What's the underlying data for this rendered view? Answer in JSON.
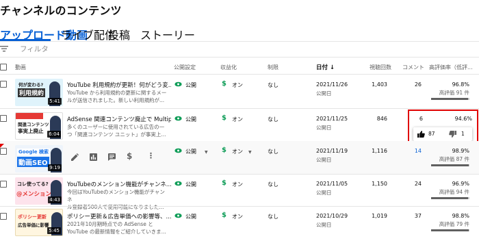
{
  "page": {
    "title": "チャンネルのコンテンツ"
  },
  "tabs": [
    {
      "label": "アップロード動画",
      "active": true
    },
    {
      "label": "ライブ配信",
      "active": false
    },
    {
      "label": "投稿",
      "active": false
    },
    {
      "label": "ストーリー",
      "active": false
    }
  ],
  "filter": {
    "placeholder": "フィルタ",
    "icon": "filter-icon"
  },
  "columns": {
    "video": "動画",
    "visibility": "公開設定",
    "monetization": "収益化",
    "restrictions": "制限",
    "date": "日付",
    "views": "視聴回数",
    "comments": "コメント",
    "likes": "高評価率（低評..."
  },
  "rows": [
    {
      "duration": "5:41",
      "thumb_top": "何が変わる?",
      "thumb_bottom": "利用規約",
      "title": "YouTube 利用規約が更新！何がどう変...",
      "desc1": "YouTube から利用規約の更新に関するメー",
      "desc2": "ルが送信されました。新しい利用規約が...",
      "visibility": "公開",
      "monetization": "オン",
      "restrictions": "なし",
      "date": "2021/11/26",
      "date_status": "公開日",
      "views": "1,403",
      "comments": "26",
      "like_rate": "96.8%",
      "like_count": "高評価 91 件",
      "like_fraction": 0.968
    },
    {
      "duration": "6:04",
      "thumb_top": "関連コンテンツ",
      "thumb_bottom": "事実上廃止",
      "title": "AdSense 関連コンテンツ廃止で Multip...",
      "desc1": "多くのユーザーに使用されている広告の一",
      "desc2": "つ「関連コンテンツ ユニット」が事実上...",
      "visibility": "公開",
      "monetization": "オン",
      "restrictions": "なし",
      "date": "2021/11/25",
      "date_status": "公開日",
      "views": "846",
      "comments": "6",
      "like_rate": "94.6%",
      "likes": "87",
      "dislikes": "1",
      "like_fraction": 0.946
    },
    {
      "duration": "9:19",
      "thumb_top": "Google 検索",
      "thumb_bottom": "動画SEO",
      "visibility": "公開",
      "monetization": "オン",
      "restrictions": "なし",
      "date": "2021/11/19",
      "date_status": "公開日",
      "views": "1,116",
      "comments": "14",
      "like_rate": "98.9%",
      "like_count": "高評価 87 件",
      "like_fraction": 0.989
    },
    {
      "duration": "4:43",
      "thumb_top": "コレ使ってる?",
      "thumb_bottom": "@メンション",
      "title": "YouTubeのメンション機能がチャンネ...",
      "desc1": "今回はYouTubeのメンション機能がチャンネ",
      "desc2": "ル登録者500人で使用可能になりました...",
      "visibility": "公開",
      "monetization": "オン",
      "restrictions": "なし",
      "date": "2021/11/05",
      "date_status": "公開日",
      "views": "1,150",
      "comments": "24",
      "like_rate": "96.9%",
      "like_count": "高評価 94 件",
      "like_fraction": 0.969
    },
    {
      "duration": "5:45",
      "thumb_top": "ポリシー更新",
      "thumb_bottom": "広告単価に影響",
      "title": "ポリシー更新＆広告単価への影響等、...",
      "desc1": "2021年10月期時点での AdSense と",
      "desc2": "YouTube の最新情報をご紹介していきま...",
      "visibility": "公開",
      "monetization": "オン",
      "restrictions": "なし",
      "date": "2021/10/29",
      "date_status": "公開日",
      "views": "1,019",
      "comments": "37",
      "like_rate": "98.8%",
      "like_count": "高評価 79 件",
      "like_fraction": 0.988
    }
  ],
  "colors": {
    "accent": "#065fd4",
    "monetization_green": "#0f9d58",
    "highlight_red": "#e00000"
  }
}
